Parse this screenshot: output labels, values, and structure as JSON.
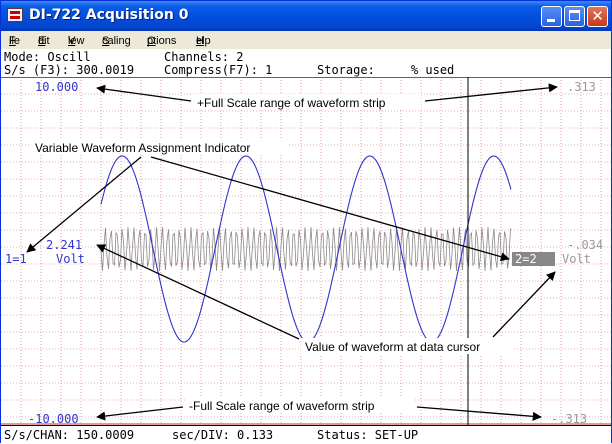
{
  "window": {
    "title": "DI-722 Acquisition 0",
    "controls": [
      "minimize",
      "maximize",
      "close"
    ],
    "close_glyph": "✕"
  },
  "menu": [
    {
      "label": "File",
      "accel": "F"
    },
    {
      "label": "Edit",
      "accel": "E"
    },
    {
      "label": "View",
      "accel": "V"
    },
    {
      "label": "Scaling",
      "accel": "S"
    },
    {
      "label": "Options",
      "accel": "O"
    },
    {
      "label": "Help",
      "accel": "H"
    }
  ],
  "status_top": {
    "mode": "Mode: Oscill",
    "channels": "Channels: 2",
    "sample_rate": "S/s (F3): 300.0019",
    "compress": "Compress(F7): 1",
    "storage": "Storage:     % used"
  },
  "plot": {
    "left_top_value": "10.000",
    "left_bottom_value": "-10.000",
    "right_top_value": ".313",
    "right_bottom_value": "-.313",
    "left_channel_id": "1=1",
    "left_channel_value": "2.241",
    "left_channel_unit": "Volt",
    "right_channel_id": "2=2",
    "right_channel_value": "-.034",
    "right_channel_unit": "Volt",
    "colors": {
      "grid": "#e06060",
      "wave1": "#3333cc",
      "wave2": "#888888",
      "cursor": "#000000",
      "blue_text": "#3333cc",
      "gray_text": "#999999"
    }
  },
  "annotations": {
    "top": "+Full Scale range of waveform strip",
    "assignment": "Variable Waveform Assignment Indicator",
    "cursor_value": "Value of waveform at data cursor",
    "bottom": "-Full Scale range of waveform strip"
  },
  "status_bottom": {
    "sps_chan": "S/s/CHAN: 150.0009",
    "sec_div": "sec/DIV: 0.133",
    "status": "Status: SET-UP"
  }
}
